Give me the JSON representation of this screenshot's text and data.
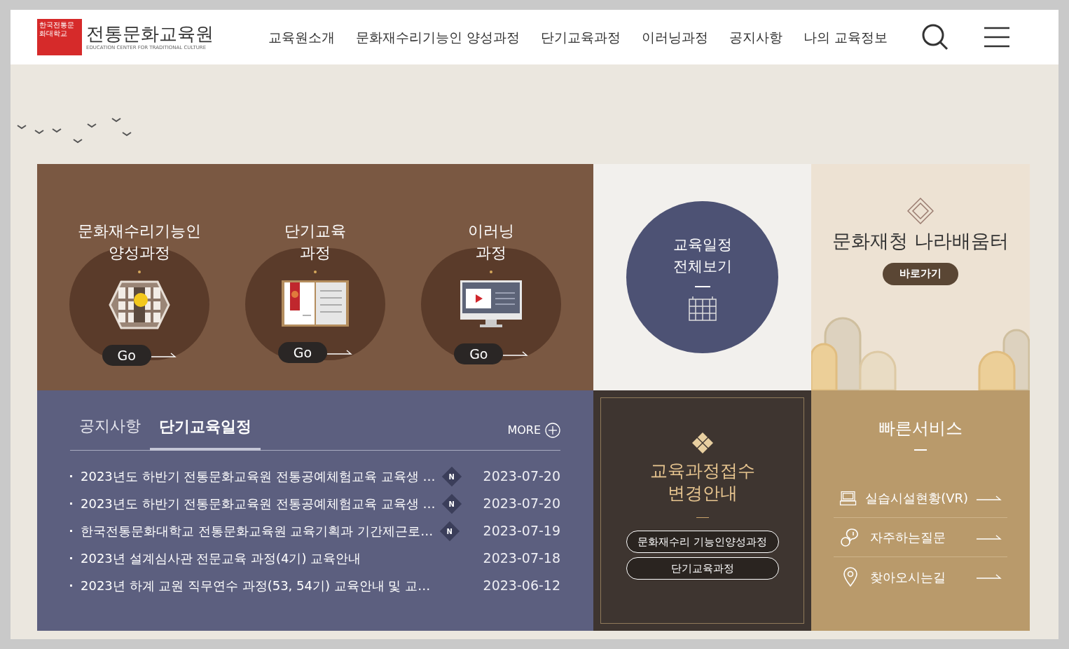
{
  "header": {
    "logo_mark": "한국전통문화대학교",
    "logo_title": "전통문화교육원",
    "logo_subtitle": "EDUCATION CENTER FOR TRADITIONAL CULTURE",
    "nav": [
      "교육원소개",
      "문화재수리기능인 양성과정",
      "단기교육과정",
      "이러닝과정",
      "공지사항",
      "나의 교육정보"
    ]
  },
  "courses": [
    {
      "kind": "window",
      "title": "문화재수리기능인\n양성과정",
      "button": "Go"
    },
    {
      "kind": "book",
      "title": "단기교육\n과정",
      "button": "Go"
    },
    {
      "kind": "monitor",
      "title": "이러닝\n과정",
      "button": "Go"
    }
  ],
  "schedule_circle": {
    "title": "교육일정\n전체보기"
  },
  "nara": {
    "title": "문화재청 나라배움터",
    "button": "바로가기"
  },
  "board": {
    "tabs": [
      {
        "label": "공지사항",
        "selected": false
      },
      {
        "label": "단기교육일정",
        "selected": true
      }
    ],
    "more": "MORE",
    "rows": [
      {
        "title": "2023년도 하반기 전통문화교육원 전통공예체험교육 교육생 …",
        "new_badge": "N",
        "date": "2023-07-20"
      },
      {
        "title": "2023년도 하반기 전통문화교육원 전통공예체험교육 교육생 …",
        "new_badge": "N",
        "date": "2023-07-20"
      },
      {
        "title": "한국전통문화대학교 전통문화교육원 교육기획과 기간제근로…",
        "new_badge": "N",
        "date": "2023-07-19"
      },
      {
        "title": "2023년 설계심사관 전문교육 과정(4기) 교육안내",
        "date": "2023-07-18"
      },
      {
        "title": "2023년 하계 교원 직무연수 과정(53, 54기) 교육안내 및 교…",
        "date": "2023-06-12"
      }
    ]
  },
  "registration": {
    "title": "교육과정접수\n변경안내",
    "buttons": [
      "문화재수리 기능인양성과정",
      "단기교육과정"
    ]
  },
  "quick": {
    "title": "빠른서비스",
    "items": [
      {
        "kind": "laptop",
        "label": "실습시설현황(VR)"
      },
      {
        "kind": "chat",
        "label": "자주하는질문"
      },
      {
        "kind": "pin",
        "label": "찾아오시는길"
      }
    ]
  }
}
